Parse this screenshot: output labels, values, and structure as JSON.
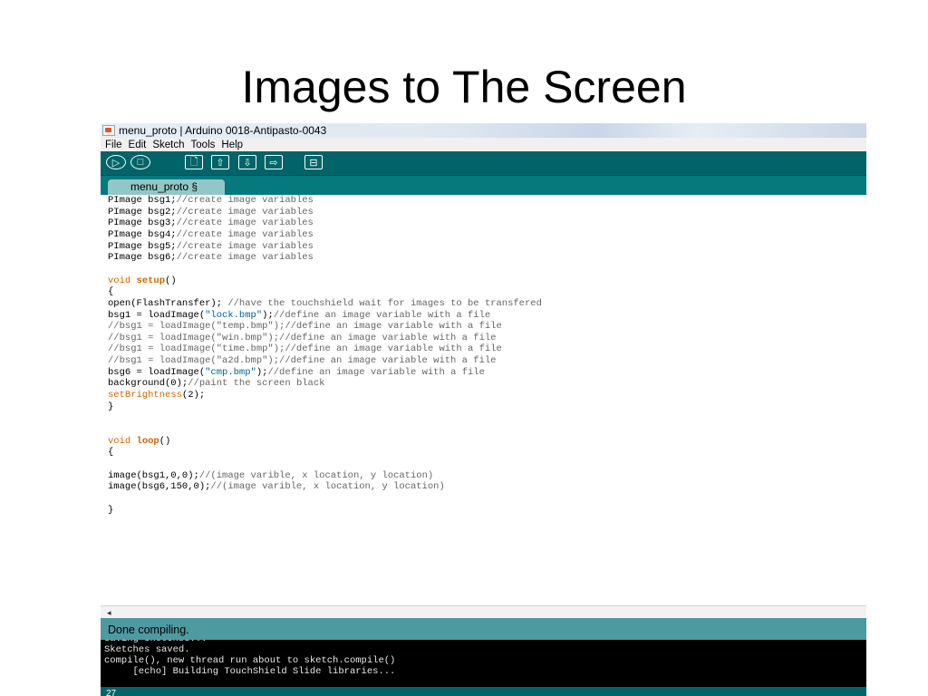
{
  "slide": {
    "title": "Images to The Screen"
  },
  "window": {
    "title": "menu_proto | Arduino 0018-Antipasto-0043"
  },
  "menu": [
    "File",
    "Edit",
    "Sketch",
    "Tools",
    "Help"
  ],
  "toolbar_buttons": [
    {
      "name": "verify-button",
      "glyph": "▷"
    },
    {
      "name": "stop-button",
      "glyph": "□"
    },
    {
      "name": "new-button",
      "glyph": "🗋"
    },
    {
      "name": "open-button",
      "glyph": "⇧"
    },
    {
      "name": "save-button",
      "glyph": "⇩"
    },
    {
      "name": "upload-button",
      "glyph": "⇨"
    },
    {
      "name": "serial-monitor-button",
      "glyph": "⊟"
    }
  ],
  "tab": {
    "label": "menu_proto §"
  },
  "code_lines": [
    [
      [
        "",
        "PImage bsg1;"
      ],
      [
        "c",
        "//create image variables"
      ]
    ],
    [
      [
        "",
        "PImage bsg2;"
      ],
      [
        "c",
        "//create image variables"
      ]
    ],
    [
      [
        "",
        "PImage bsg3;"
      ],
      [
        "c",
        "//create image variables"
      ]
    ],
    [
      [
        "",
        "PImage bsg4;"
      ],
      [
        "c",
        "//create image variables"
      ]
    ],
    [
      [
        "",
        "PImage bsg5;"
      ],
      [
        "c",
        "//create image variables"
      ]
    ],
    [
      [
        "",
        "PImage bsg6;"
      ],
      [
        "c",
        "//create image variables"
      ]
    ],
    [],
    [
      [
        "kw",
        "void "
      ],
      [
        "kwb",
        "setup"
      ],
      [
        "",
        "()"
      ]
    ],
    [
      [
        "",
        "{"
      ]
    ],
    [
      [
        "",
        "open(FlashTransfer); "
      ],
      [
        "c",
        "//have the touchshield wait for images to be transfered"
      ]
    ],
    [
      [
        "",
        "bsg1 = loadImage("
      ],
      [
        "str",
        "\"lock.bmp\""
      ],
      [
        "",
        ");"
      ],
      [
        "c",
        "//define an image variable with a file"
      ]
    ],
    [
      [
        "c",
        "//bsg1 = loadImage(\"temp.bmp\");//define an image variable with a file"
      ]
    ],
    [
      [
        "c",
        "//bsg1 = loadImage(\"win.bmp\");//define an image variable with a file"
      ]
    ],
    [
      [
        "c",
        "//bsg1 = loadImage(\"time.bmp\");//define an image variable with a file"
      ]
    ],
    [
      [
        "c",
        "//bsg1 = loadImage(\"a2d.bmp\");//define an image variable with a file"
      ]
    ],
    [
      [
        "",
        "bsg6 = loadImage("
      ],
      [
        "str",
        "\"cmp.bmp\""
      ],
      [
        "",
        ");"
      ],
      [
        "c",
        "//define an image variable with a file"
      ]
    ],
    [
      [
        "",
        "background(0);"
      ],
      [
        "c",
        "//paint the screen black"
      ]
    ],
    [
      [
        "kw",
        "setBrightness"
      ],
      [
        "",
        "(2);"
      ]
    ],
    [
      [
        "",
        "}"
      ]
    ],
    [],
    [],
    [
      [
        "kw",
        "void "
      ],
      [
        "kwb",
        "loop"
      ],
      [
        "",
        "()"
      ]
    ],
    [
      [
        "",
        "{"
      ]
    ],
    [],
    [
      [
        "",
        "image(bsg1,0,0);"
      ],
      [
        "c",
        "//(image varible, x location, y location)"
      ]
    ],
    [
      [
        "",
        "image(bsg6,150,0);"
      ],
      [
        "c",
        "//(image varible, x location, y location)"
      ]
    ],
    [],
    [
      [
        "",
        "}"
      ]
    ]
  ],
  "hscroll": {
    "left_arrow": "◂"
  },
  "status": {
    "text": "Done compiling."
  },
  "console": {
    "lines": [
      "Saving sketches...",
      "Sketches saved.",
      "compile(), new thread run about to sketch.compile()",
      "     [echo] Building TouchShield Slide libraries..."
    ]
  },
  "line_number": "27",
  "colors": {
    "toolbar": "#006468",
    "tabbar": "#04797e",
    "tab": "#93c7c7",
    "status": "#4d9aa0",
    "keyword": "#cc6600",
    "string": "#006699",
    "comment": "#666666"
  }
}
